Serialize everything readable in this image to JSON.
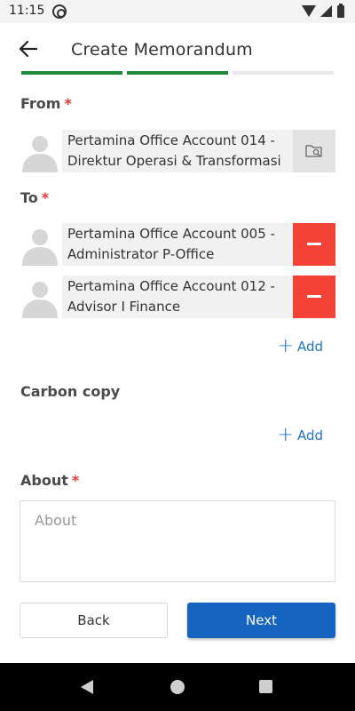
{
  "status_bar": {
    "time": "11:15",
    "icons": [
      "at-sign-icon",
      "wifi-icon",
      "signal-icon",
      "battery-icon"
    ]
  },
  "header": {
    "title": "Create Memorandum",
    "back_icon": "arrow-left-icon"
  },
  "progress": {
    "steps_total": 3,
    "steps_done": 2,
    "done_color": "#1f8a3a"
  },
  "from": {
    "label": "From",
    "required_mark": "*",
    "person": {
      "line1": "Pertamina Office Account 014 -",
      "line2": "Direktur Operasi & Transformasi"
    }
  },
  "to": {
    "label": "To",
    "required_mark": "*",
    "recipients": [
      {
        "line1": "Pertamina Office Account 005 -",
        "line2": "Administrator P-Office"
      },
      {
        "line1": "Pertamina Office Account 012 -",
        "line2": "Advisor I Finance"
      }
    ],
    "add_label": "Add"
  },
  "carbon_copy": {
    "label": "Carbon copy",
    "add_label": "Add"
  },
  "about": {
    "label": "About",
    "required_mark": "*",
    "placeholder": "About",
    "value": ""
  },
  "actions": {
    "back_label": "Back",
    "next_label": "Next"
  },
  "colors": {
    "accent": "#1565c0",
    "link": "#1f73c9",
    "danger": "#f44336",
    "required": "#e53935"
  }
}
